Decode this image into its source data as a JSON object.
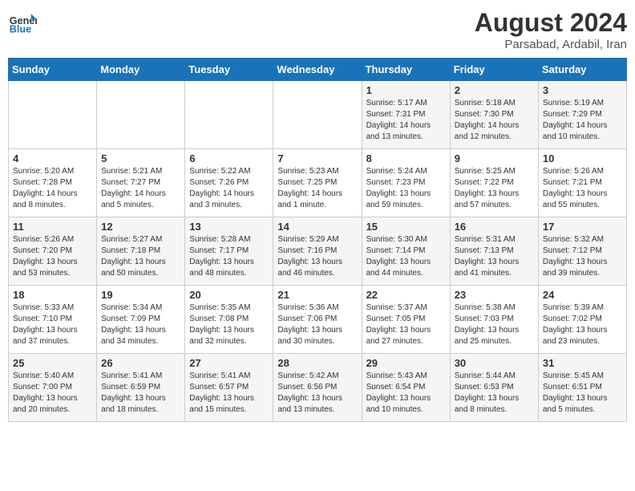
{
  "header": {
    "logo_text_general": "General",
    "logo_text_blue": "Blue",
    "month_year": "August 2024",
    "location": "Parsabad, Ardabil, Iran"
  },
  "days_of_week": [
    "Sunday",
    "Monday",
    "Tuesday",
    "Wednesday",
    "Thursday",
    "Friday",
    "Saturday"
  ],
  "weeks": [
    [
      {
        "day": "",
        "sunrise": "",
        "sunset": "",
        "daylight": ""
      },
      {
        "day": "",
        "sunrise": "",
        "sunset": "",
        "daylight": ""
      },
      {
        "day": "",
        "sunrise": "",
        "sunset": "",
        "daylight": ""
      },
      {
        "day": "",
        "sunrise": "",
        "sunset": "",
        "daylight": ""
      },
      {
        "day": "1",
        "sunrise": "5:17 AM",
        "sunset": "7:31 PM",
        "daylight": "14 hours and 13 minutes."
      },
      {
        "day": "2",
        "sunrise": "5:18 AM",
        "sunset": "7:30 PM",
        "daylight": "14 hours and 12 minutes."
      },
      {
        "day": "3",
        "sunrise": "5:19 AM",
        "sunset": "7:29 PM",
        "daylight": "14 hours and 10 minutes."
      }
    ],
    [
      {
        "day": "4",
        "sunrise": "5:20 AM",
        "sunset": "7:28 PM",
        "daylight": "14 hours and 8 minutes."
      },
      {
        "day": "5",
        "sunrise": "5:21 AM",
        "sunset": "7:27 PM",
        "daylight": "14 hours and 5 minutes."
      },
      {
        "day": "6",
        "sunrise": "5:22 AM",
        "sunset": "7:26 PM",
        "daylight": "14 hours and 3 minutes."
      },
      {
        "day": "7",
        "sunrise": "5:23 AM",
        "sunset": "7:25 PM",
        "daylight": "14 hours and 1 minute."
      },
      {
        "day": "8",
        "sunrise": "5:24 AM",
        "sunset": "7:23 PM",
        "daylight": "13 hours and 59 minutes."
      },
      {
        "day": "9",
        "sunrise": "5:25 AM",
        "sunset": "7:22 PM",
        "daylight": "13 hours and 57 minutes."
      },
      {
        "day": "10",
        "sunrise": "5:26 AM",
        "sunset": "7:21 PM",
        "daylight": "13 hours and 55 minutes."
      }
    ],
    [
      {
        "day": "11",
        "sunrise": "5:26 AM",
        "sunset": "7:20 PM",
        "daylight": "13 hours and 53 minutes."
      },
      {
        "day": "12",
        "sunrise": "5:27 AM",
        "sunset": "7:18 PM",
        "daylight": "13 hours and 50 minutes."
      },
      {
        "day": "13",
        "sunrise": "5:28 AM",
        "sunset": "7:17 PM",
        "daylight": "13 hours and 48 minutes."
      },
      {
        "day": "14",
        "sunrise": "5:29 AM",
        "sunset": "7:16 PM",
        "daylight": "13 hours and 46 minutes."
      },
      {
        "day": "15",
        "sunrise": "5:30 AM",
        "sunset": "7:14 PM",
        "daylight": "13 hours and 44 minutes."
      },
      {
        "day": "16",
        "sunrise": "5:31 AM",
        "sunset": "7:13 PM",
        "daylight": "13 hours and 41 minutes."
      },
      {
        "day": "17",
        "sunrise": "5:32 AM",
        "sunset": "7:12 PM",
        "daylight": "13 hours and 39 minutes."
      }
    ],
    [
      {
        "day": "18",
        "sunrise": "5:33 AM",
        "sunset": "7:10 PM",
        "daylight": "13 hours and 37 minutes."
      },
      {
        "day": "19",
        "sunrise": "5:34 AM",
        "sunset": "7:09 PM",
        "daylight": "13 hours and 34 minutes."
      },
      {
        "day": "20",
        "sunrise": "5:35 AM",
        "sunset": "7:08 PM",
        "daylight": "13 hours and 32 minutes."
      },
      {
        "day": "21",
        "sunrise": "5:36 AM",
        "sunset": "7:06 PM",
        "daylight": "13 hours and 30 minutes."
      },
      {
        "day": "22",
        "sunrise": "5:37 AM",
        "sunset": "7:05 PM",
        "daylight": "13 hours and 27 minutes."
      },
      {
        "day": "23",
        "sunrise": "5:38 AM",
        "sunset": "7:03 PM",
        "daylight": "13 hours and 25 minutes."
      },
      {
        "day": "24",
        "sunrise": "5:39 AM",
        "sunset": "7:02 PM",
        "daylight": "13 hours and 23 minutes."
      }
    ],
    [
      {
        "day": "25",
        "sunrise": "5:40 AM",
        "sunset": "7:00 PM",
        "daylight": "13 hours and 20 minutes."
      },
      {
        "day": "26",
        "sunrise": "5:41 AM",
        "sunset": "6:59 PM",
        "daylight": "13 hours and 18 minutes."
      },
      {
        "day": "27",
        "sunrise": "5:41 AM",
        "sunset": "6:57 PM",
        "daylight": "13 hours and 15 minutes."
      },
      {
        "day": "28",
        "sunrise": "5:42 AM",
        "sunset": "6:56 PM",
        "daylight": "13 hours and 13 minutes."
      },
      {
        "day": "29",
        "sunrise": "5:43 AM",
        "sunset": "6:54 PM",
        "daylight": "13 hours and 10 minutes."
      },
      {
        "day": "30",
        "sunrise": "5:44 AM",
        "sunset": "6:53 PM",
        "daylight": "13 hours and 8 minutes."
      },
      {
        "day": "31",
        "sunrise": "5:45 AM",
        "sunset": "6:51 PM",
        "daylight": "13 hours and 5 minutes."
      }
    ]
  ]
}
